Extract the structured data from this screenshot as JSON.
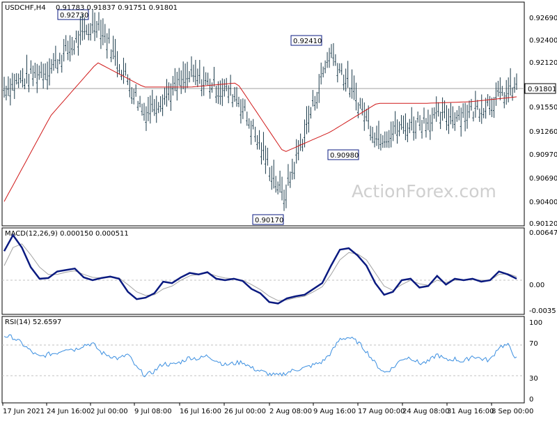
{
  "chart_data": [
    {
      "type": "ohlc-bar",
      "title": "USDCHF,H4",
      "ohlc_readout": "0.91783 0.91837 0.91751 0.91801",
      "overlay": "moving average (red)",
      "ylim": [
        0.9012,
        0.9283
      ],
      "yticks": [
        "0.92690",
        "0.92400",
        "0.92120",
        "0.91830",
        "0.91550",
        "0.91260",
        "0.90970",
        "0.90690",
        "0.90400",
        "0.90120"
      ],
      "current_price": "0.91801",
      "annotations": [
        {
          "label": "0.92730",
          "value": 0.9273,
          "at": "2 Jul 00:00"
        },
        {
          "label": "0.92410",
          "value": 0.9241,
          "at": "9 Aug 16:00"
        },
        {
          "label": "0.90980",
          "value": 0.9098,
          "at": "17 Aug 00:00"
        },
        {
          "label": "0.90170",
          "value": 0.9017,
          "at": "2 Aug 08:00"
        }
      ],
      "watermark": "ActionForex.com",
      "series": [
        {
          "name": "close",
          "dates": [
            "17 Jun 2021",
            "24 Jun 16:00",
            "2 Jul 00:00",
            "9 Jul 08:00",
            "16 Jul 16:00",
            "26 Jul 00:00",
            "2 Aug 08:00",
            "9 Aug 16:00",
            "17 Aug 00:00",
            "24 Aug 08:00",
            "31 Aug 16:00",
            "8 Sep 00:00"
          ],
          "values": [
            0.918,
            0.9205,
            0.9262,
            0.915,
            0.9195,
            0.917,
            0.9045,
            0.9225,
            0.912,
            0.914,
            0.915,
            0.918
          ]
        },
        {
          "name": "moving average",
          "dates": [
            "17 Jun 2021",
            "24 Jun 16:00",
            "2 Jul 00:00",
            "9 Jul 08:00",
            "16 Jul 16:00",
            "26 Jul 00:00",
            "2 Aug 08:00",
            "9 Aug 16:00",
            "17 Aug 00:00",
            "24 Aug 08:00",
            "31 Aug 16:00",
            "8 Sep 00:00"
          ],
          "values": [
            0.904,
            0.9145,
            0.921,
            0.918,
            0.918,
            0.9185,
            0.91,
            0.9125,
            0.916,
            0.916,
            0.9162,
            0.9168
          ]
        }
      ]
    },
    {
      "type": "line",
      "title": "MACD(12,26,9) 0.000150 0.000511",
      "ylim": [
        -0.0045,
        0.0069
      ],
      "yticks": [
        "0.006473",
        "0.00",
        "-0.0035"
      ],
      "zero_line": true,
      "series": [
        {
          "name": "MACD",
          "values": [
            0.004,
            0.0062,
            0.0045,
            0.0018,
            0.0002,
            0.0003,
            0.0012,
            0.0014,
            0.0016,
            0.0004,
            0.0,
            0.0003,
            0.0005,
            0.0002,
            -0.0016,
            -0.0026,
            -0.0024,
            -0.0018,
            -0.0002,
            -0.0004,
            0.0004,
            0.001,
            0.0008,
            0.0011,
            0.0002,
            0.0,
            0.0002,
            -0.0001,
            -0.0012,
            -0.0018,
            -0.003,
            -0.0032,
            -0.0025,
            -0.0022,
            -0.002,
            -0.0012,
            -0.0004,
            0.002,
            0.0042,
            0.0044,
            0.0034,
            0.002,
            -0.0004,
            -0.002,
            -0.0016,
            0.0,
            0.0002,
            -0.001,
            -0.0008,
            0.0006,
            -0.0006,
            0.0002,
            0.0,
            0.0002,
            -0.0002,
            0.0,
            0.0012,
            0.0008,
            0.0002
          ]
        },
        {
          "name": "signal",
          "values": [
            0.002,
            0.0045,
            0.005,
            0.0035,
            0.0018,
            0.0008,
            0.0008,
            0.0011,
            0.0013,
            0.0008,
            0.0004,
            0.0003,
            0.0004,
            0.0003,
            -0.0006,
            -0.0016,
            -0.0021,
            -0.002,
            -0.0012,
            -0.0008,
            0.0,
            0.0006,
            0.0008,
            0.001,
            0.0006,
            0.0003,
            0.0002,
            0.0,
            -0.0006,
            -0.0013,
            -0.0022,
            -0.0028,
            -0.0027,
            -0.0024,
            -0.0022,
            -0.0016,
            -0.0009,
            0.0008,
            0.0028,
            0.0038,
            0.0036,
            0.0028,
            0.001,
            -0.0008,
            -0.0014,
            -0.0006,
            0.0,
            -0.0005,
            -0.0007,
            0.0,
            -0.0003,
            0.0,
            0.0,
            0.0001,
            0.0,
            0.0,
            0.0008,
            0.0009,
            0.0005
          ]
        }
      ]
    },
    {
      "type": "line",
      "title": "RSI(14) 52.6597",
      "ylim": [
        0,
        100
      ],
      "yticks": [
        "100",
        "70",
        "30",
        "0"
      ],
      "levels": [
        70,
        30
      ],
      "series": [
        {
          "name": "RSI",
          "values": [
            82,
            80,
            72,
            62,
            54,
            58,
            60,
            66,
            64,
            70,
            72,
            60,
            56,
            52,
            58,
            40,
            30,
            36,
            46,
            44,
            48,
            54,
            52,
            56,
            50,
            44,
            46,
            48,
            40,
            36,
            32,
            30,
            34,
            38,
            40,
            44,
            48,
            60,
            78,
            80,
            74,
            62,
            46,
            34,
            40,
            52,
            54,
            46,
            48,
            58,
            50,
            52,
            48,
            56,
            52,
            50,
            68,
            70,
            52
          ]
        }
      ]
    }
  ],
  "x_axis_labels": [
    "17 Jun 2021",
    "24 Jun 16:00",
    "2 Jul 00:00",
    "9 Jul 08:00",
    "16 Jul 16:00",
    "26 Jul 00:00",
    "2 Aug 08:00",
    "9 Aug 16:00",
    "17 Aug 00:00",
    "24 Aug 08:00",
    "31 Aug 16:00",
    "8 Sep 00:00"
  ],
  "colors": {
    "price_bars": "#1a3a4a",
    "moving_average": "#d01818",
    "macd": "#0a1a80",
    "macd_signal": "#a0a0a0",
    "rsi": "#3a8ee0",
    "current_price_label_bg": "#ffffff"
  }
}
